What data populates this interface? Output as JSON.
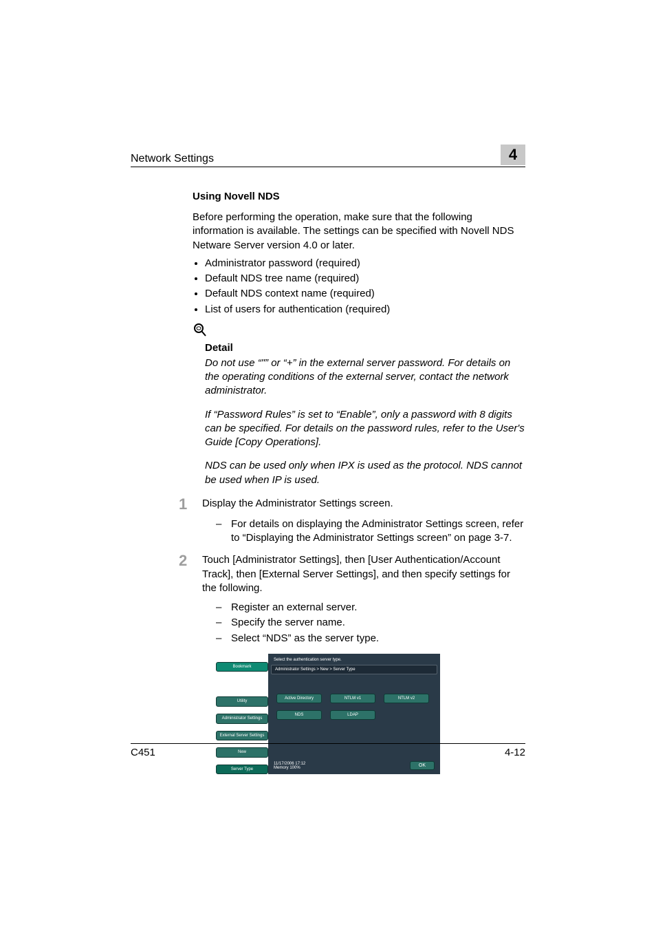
{
  "header": {
    "title": "Network Settings",
    "chapter": "4"
  },
  "section": {
    "heading": "Using Novell NDS",
    "intro": "Before performing the operation, make sure that the following information is available. The settings can be specified with Novell NDS Netware Server version 4.0 or later.",
    "bullets": [
      "Administrator password (required)",
      "Default NDS tree name (required)",
      "Default NDS context name (required)",
      "List of users for authentication (required)"
    ]
  },
  "detail": {
    "title": "Detail",
    "p1": "Do not use “\"” or “+” in the external server password. For details on the operating conditions of the external server, contact the network administrator.",
    "p2": "If “Password Rules” is set to “Enable”, only a password with 8 digits can be specified. For details on the password rules, refer to the User's Guide [Copy Operations].",
    "p3": "NDS can be used only when IPX is used as the protocol. NDS cannot be used when IP is used."
  },
  "steps": [
    {
      "num": "1",
      "text": "Display the Administrator Settings screen.",
      "subs": [
        "For details on displaying the Administrator Settings screen, refer to “Displaying the Administrator Settings screen” on page 3-7."
      ]
    },
    {
      "num": "2",
      "text": "Touch [Administrator Settings], then [User Authentication/Account Track], then [External Server Settings], and then specify settings for the following.",
      "subs": [
        "Register an external server.",
        "Specify the server name.",
        "Select “NDS” as the server type."
      ]
    }
  ],
  "screenshot": {
    "instr": "Select the authentication server type.",
    "crumb": "Administrator Settings > New > Server Type",
    "side": {
      "bookmark": "Bookmark",
      "utility": "Utility",
      "admin": "Administrator Settings",
      "ext": "External Server Settings",
      "new": "New",
      "server_type": "Server Type"
    },
    "options": {
      "ad": "Active Directory",
      "ntlmv1": "NTLM v1",
      "ntlmv2": "NTLM v2",
      "nds": "NDS",
      "ldap": "LDAP"
    },
    "datetime": "11/17/2006   17:12",
    "memory": "Memory        100%",
    "ok": "OK"
  },
  "footer": {
    "model": "C451",
    "page": "4-12"
  }
}
